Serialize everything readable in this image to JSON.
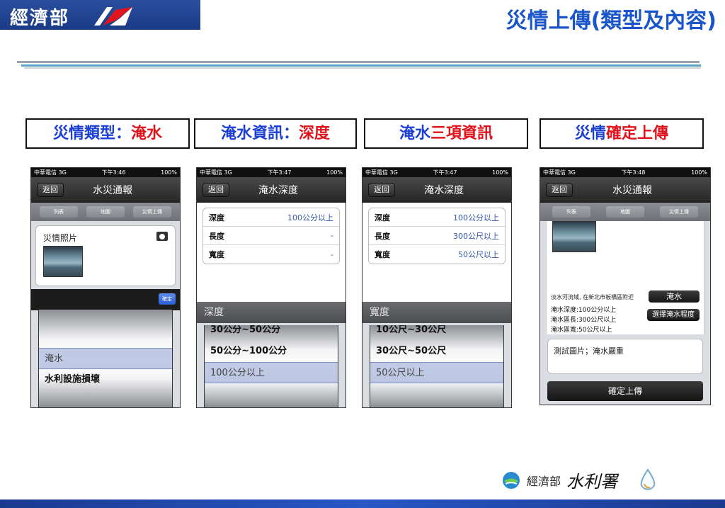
{
  "header": {
    "ministry_logo": "經濟部",
    "title": "災情上傳(類型及內容)"
  },
  "steps": [
    {
      "part1": "災情類型：",
      "part2": "淹水"
    },
    {
      "part1": "淹水資訊：",
      "part2": "深度"
    },
    {
      "part1": "淹水",
      "part2": "三項資訊"
    },
    {
      "part1": "災情",
      "part2": "確定上傳"
    }
  ],
  "colors": {
    "accent_blue": "#1c3fd4",
    "accent_red": "#e0141c",
    "title_blue": "#1a56c9"
  },
  "phone1": {
    "status": {
      "carrier": "中華電信 3G",
      "time": "下午3:46",
      "battery": "100%"
    },
    "back": "返回",
    "title": "水災通報",
    "tabs": [
      "列表",
      "地圖",
      "災情上傳"
    ],
    "photo_label": "災情照片",
    "confirm": "確定",
    "picker": [
      "淹水",
      "水利設施損壞"
    ]
  },
  "phone2": {
    "status": {
      "carrier": "中華電信 3G",
      "time": "下午3:47",
      "battery": "100%"
    },
    "back": "返回",
    "title": "淹水深度",
    "rows": [
      {
        "label": "深度",
        "value": "100公分以上"
      },
      {
        "label": "長度",
        "value": "-"
      },
      {
        "label": "寬度",
        "value": "-"
      }
    ],
    "picker_head": "深度",
    "picker": [
      "30公分~50公分",
      "50公分~100公分",
      "100公分以上"
    ]
  },
  "phone3": {
    "status": {
      "carrier": "中華電信 3G",
      "time": "下午3:47",
      "battery": "100%"
    },
    "back": "返回",
    "title": "淹水深度",
    "rows": [
      {
        "label": "深度",
        "value": "100公分以上"
      },
      {
        "label": "長度",
        "value": "300公尺以上"
      },
      {
        "label": "寬度",
        "value": "50公尺以上"
      }
    ],
    "picker_head": "寬度",
    "picker": [
      "10公尺~30公尺",
      "30公尺~50公尺",
      "50公尺以上"
    ]
  },
  "phone4": {
    "status": {
      "carrier": "中華電信 3G",
      "time": "下午3:48",
      "battery": "100%"
    },
    "back": "返回",
    "title": "水災通報",
    "tabs": [
      "列表",
      "地圖",
      "災情上傳"
    ],
    "location": "淡水河流域, 在新北市板橋區附近",
    "type_button": "淹水",
    "depth": "淹水深度:100公分以上",
    "length": "淹水區長:300公尺以上",
    "width": "淹水區寬:50公尺以上",
    "level_button": "選擇淹水程度",
    "note": "測試圖片；淹水嚴重",
    "upload": "確定上傳"
  },
  "footer": {
    "ministry_small": "經濟部",
    "ministry_large": "水利署"
  }
}
